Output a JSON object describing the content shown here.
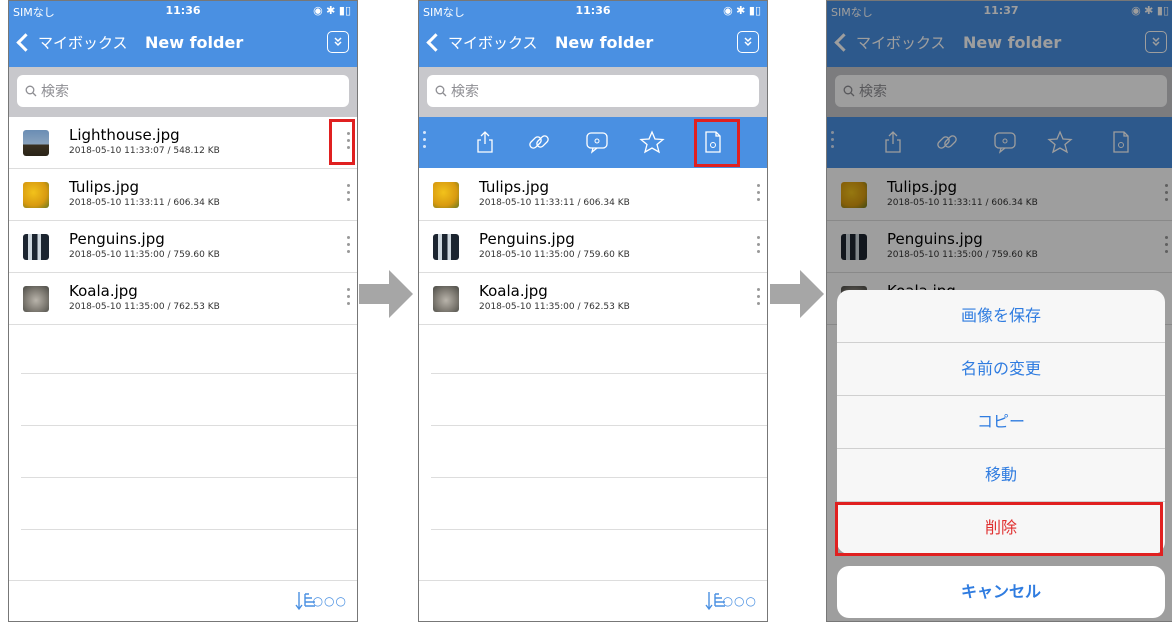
{
  "status": {
    "carrier": "SIMなし",
    "time1": "11:36",
    "time2": "11:36",
    "time3": "11:37"
  },
  "nav": {
    "back_label": "マイボックス",
    "title": "New folder"
  },
  "search": {
    "placeholder": "検索"
  },
  "files": [
    {
      "name": "Lighthouse.jpg",
      "meta": "2018-05-10 11:33:07 / 548.12 KB"
    },
    {
      "name": "Tulips.jpg",
      "meta": "2018-05-10 11:33:11 / 606.34 KB"
    },
    {
      "name": "Penguins.jpg",
      "meta": "2018-05-10 11:35:00 / 759.60 KB"
    },
    {
      "name": "Koala.jpg",
      "meta": "2018-05-10 11:35:00 / 762.53 KB"
    }
  ],
  "partial_file_name": "Koala.jpg",
  "toolbar": {
    "more": "○○○"
  },
  "action_sheet": {
    "items": [
      "画像を保存",
      "名前の変更",
      "コピー",
      "移動"
    ],
    "delete": "削除",
    "cancel": "キャンセル"
  },
  "colors": {
    "accent": "#4a90e2",
    "highlight": "#e02020",
    "delete_text": "#e03030"
  }
}
